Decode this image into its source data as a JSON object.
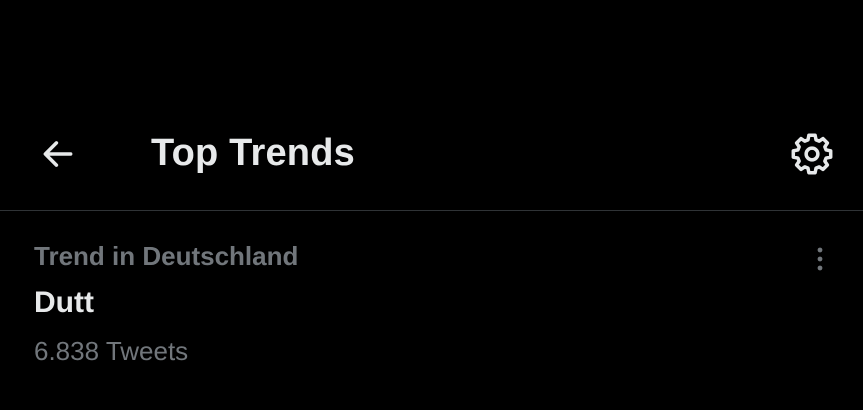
{
  "header": {
    "back_icon": "arrow-left-icon",
    "title": "Top Trends",
    "settings_icon": "gear-icon"
  },
  "trend": {
    "context": "Trend in Deutschland",
    "name": "Dutt",
    "count": "6.838 Tweets",
    "more_icon": "vertical-dots-icon"
  },
  "colors": {
    "background": "#000000",
    "primary_text": "#e7e9ea",
    "secondary_text": "#71767b",
    "divider": "#2f3336"
  }
}
